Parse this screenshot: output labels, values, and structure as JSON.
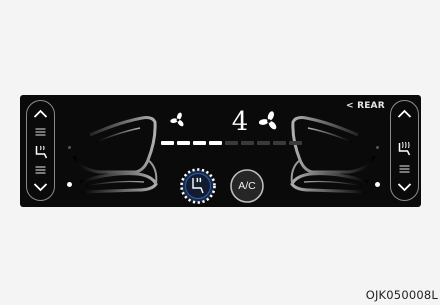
{
  "fan": {
    "speed_text": "4",
    "level": 4,
    "max_level": 9
  },
  "rear": {
    "label": "< REAR"
  },
  "ac": {
    "label": "A/C"
  },
  "caption": {
    "code": "OJK050008L"
  },
  "colors": {
    "panel": "#0a0a0a",
    "outline": "#8a8a8a",
    "bar_on": "#ffffff",
    "bar_off": "#3a3a3a",
    "seat": "#a8a8a8",
    "accent_ring": "#2a5db0"
  },
  "icons": {
    "left_controls": [
      "chevron-up-icon",
      "menu-icon",
      "heated-seat-icon",
      "menu-icon",
      "chevron-down-icon"
    ],
    "right_controls": [
      "chevron-up-icon",
      "heated-steering-icon",
      "menu-icon",
      "chevron-down-icon"
    ],
    "fan_low": "fan-icon",
    "fan_high": "fan-icon",
    "seat_ventilation": "ventilated-seat-icon"
  }
}
